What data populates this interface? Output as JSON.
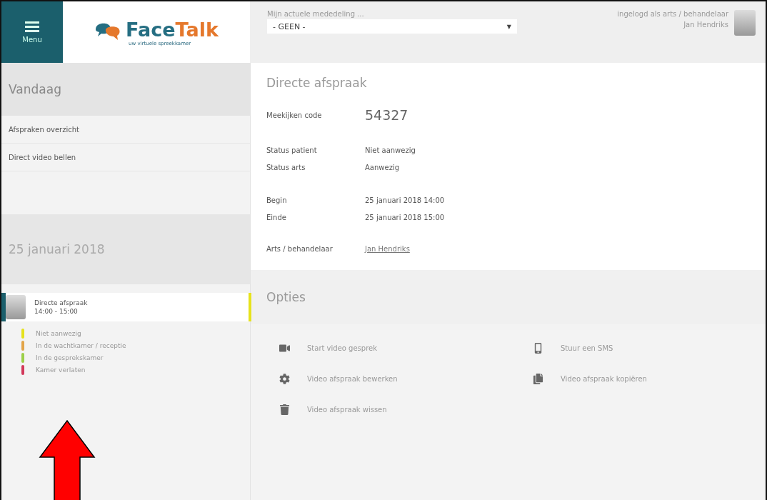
{
  "header": {
    "menu_label": "Menu",
    "logo": {
      "name_a": "Face",
      "name_b": "Talk",
      "tagline": "uw virtuele spreekkamer"
    },
    "notice": {
      "label": "Mijn actuele mededeling ...",
      "value": "- GEEN -",
      "caret": "▼"
    },
    "user": {
      "role": "ingelogd als arts / behandelaar",
      "name": "Jan Hendriks"
    }
  },
  "sidebar": {
    "title": "Vandaag",
    "items": [
      "Afspraken overzicht",
      "Direct video bellen"
    ],
    "date": "25 januari 2018",
    "appointments": [
      {
        "title": "Directe afspraak",
        "time": "14:00 - 15:00",
        "selected": true,
        "color": "#e6e21c"
      }
    ],
    "legend": [
      {
        "label": "Niet aanwezig",
        "color": "#e6e21c"
      },
      {
        "label": "In de wachtkamer / receptie",
        "color": "#e2a448"
      },
      {
        "label": "In de gesprekskamer",
        "color": "#9ccf48"
      },
      {
        "label": "Kamer verlaten",
        "color": "#d2385a"
      }
    ]
  },
  "detail": {
    "title": "Directe afspraak",
    "code_label": "Meekijken code",
    "code": "54327",
    "groups": [
      [
        {
          "label": "Status patient",
          "value": "Niet aanwezig"
        },
        {
          "label": "Status arts",
          "value": "Aanwezig"
        }
      ],
      [
        {
          "label": "Begin",
          "value": "25 januari 2018 14:00"
        },
        {
          "label": "Einde",
          "value": "25 januari 2018 15:00"
        }
      ]
    ],
    "doctor_label": "Arts / behandelaar",
    "doctor": "Jan Hendriks"
  },
  "options": {
    "title": "Opties",
    "actions": [
      {
        "kind": "video",
        "label": "Start video gesprek"
      },
      {
        "kind": "sms",
        "label": "Stuur een SMS"
      },
      {
        "kind": "edit",
        "label": "Video afspraak bewerken"
      },
      {
        "kind": "copy",
        "label": "Video afspraak kopiëren"
      },
      {
        "kind": "delete",
        "label": "Video afspraak wissen"
      }
    ]
  }
}
